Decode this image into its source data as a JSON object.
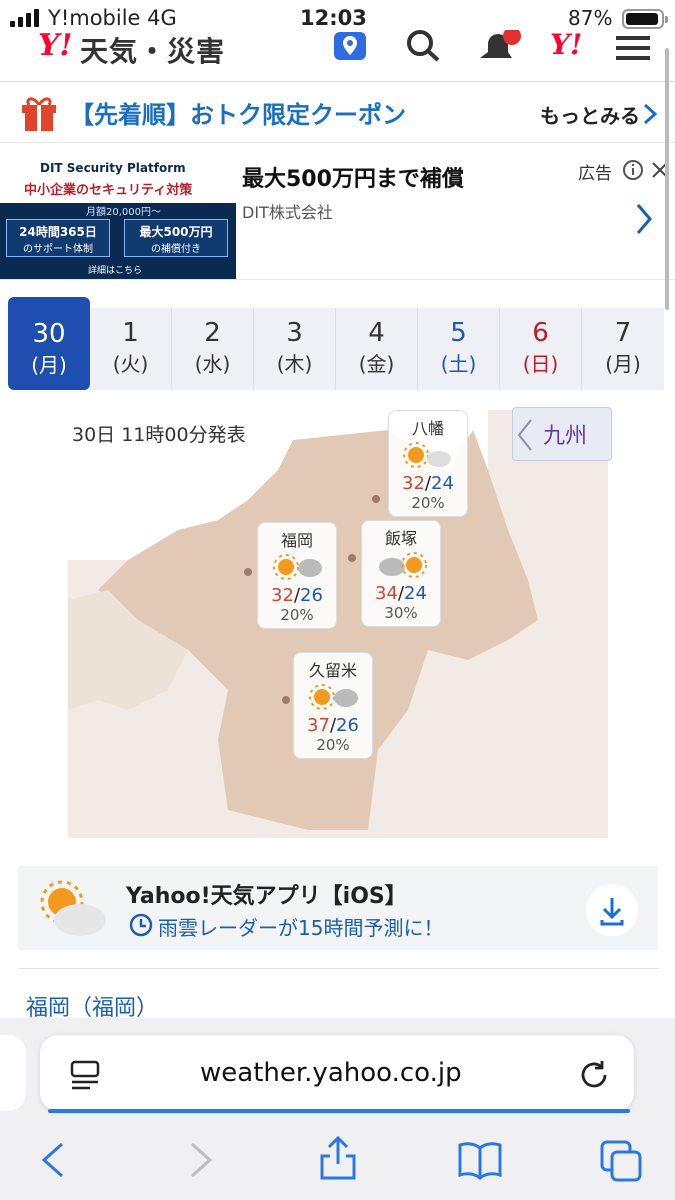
{
  "status_bar": {
    "carrier": "Y!mobile  4G",
    "time": "12:03",
    "battery": "87%"
  },
  "header": {
    "logo": "Y!",
    "title": "天気・災害",
    "icons": [
      "location-pin-icon",
      "search-icon",
      "bell-icon",
      "yahoo-icon",
      "menu-icon"
    ]
  },
  "coupon": {
    "text": "【先着順】おトク限定クーポン",
    "more": "もっとみる"
  },
  "ad": {
    "image_heading": "DIT Security Platform",
    "image_tagline": "中小企業のセキュリティ対策",
    "image_price": "月額20,000円〜",
    "image_box1_line1": "24時間365日",
    "image_box1_line2": "のサポート体制",
    "image_box2_line1": "最大500万円",
    "image_box2_line2": "の補償付き",
    "image_footer": "詳細はこちら",
    "title": "最大500万円まで補償",
    "advertiser": "DIT株式会社",
    "label": "広告"
  },
  "date_tabs": [
    {
      "day": "30",
      "weekday": "(月)",
      "kind": "active"
    },
    {
      "day": "1",
      "weekday": "(火)",
      "kind": "weekday"
    },
    {
      "day": "2",
      "weekday": "(水)",
      "kind": "weekday"
    },
    {
      "day": "3",
      "weekday": "(木)",
      "kind": "weekday"
    },
    {
      "day": "4",
      "weekday": "(金)",
      "kind": "weekday"
    },
    {
      "day": "5",
      "weekday": "(土)",
      "kind": "sat"
    },
    {
      "day": "6",
      "weekday": "(日)",
      "kind": "sun"
    },
    {
      "day": "7",
      "weekday": "(月)",
      "kind": "weekday"
    }
  ],
  "map": {
    "announced": "30日 11時00分発表",
    "region_button": "九州",
    "cities": [
      {
        "name": "八幡",
        "high": "32",
        "low": "24",
        "precip": "20%",
        "icon": "sun-cloud-icon"
      },
      {
        "name": "福岡",
        "high": "32",
        "low": "26",
        "precip": "20%",
        "icon": "sun-cloud-icon"
      },
      {
        "name": "飯塚",
        "high": "34",
        "low": "24",
        "precip": "30%",
        "icon": "cloud-sun-icon"
      },
      {
        "name": "久留米",
        "high": "37",
        "low": "26",
        "precip": "20%",
        "icon": "sun-cloud-icon"
      }
    ]
  },
  "app_promo": {
    "title": "Yahoo!天気アプリ【iOS】",
    "subtitle": "雨雲レーダーが15時間予測に！"
  },
  "section_link": "福岡（福岡）",
  "browser": {
    "url": "weather.yahoo.co.jp"
  }
}
